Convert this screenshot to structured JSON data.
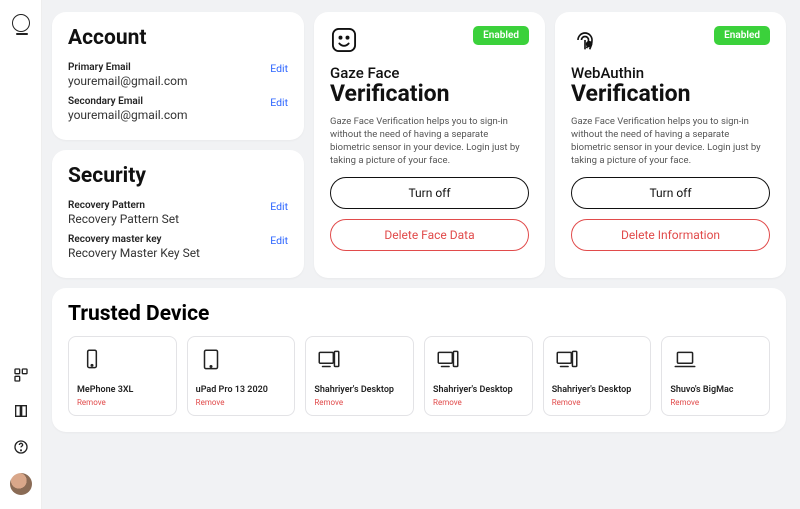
{
  "account": {
    "title": "Account",
    "primary_label": "Primary Email",
    "primary_value": "youremail@gmail.com",
    "secondary_label": "Secondary Email",
    "secondary_value": "youremail@gmail.com",
    "edit": "Edit"
  },
  "security": {
    "title": "Security",
    "pattern_label": "Recovery Pattern",
    "pattern_value": "Recovery Pattern Set",
    "master_label": "Recovery master key",
    "master_value": "Recovery Master Key Set",
    "edit": "Edit"
  },
  "verification": {
    "enabled_badge": "Enabled",
    "gaze": {
      "title_small": "Gaze Face",
      "title_big": "Verification",
      "desc": "Gaze Face Verification helps you to sign-in without the need of having a separate biometric sensor in your device. Login just by taking a picture of your face.",
      "turn_off": "Turn off",
      "delete": "Delete Face Data"
    },
    "webauthn": {
      "title_small": "WebAuthin",
      "title_big": "Verification",
      "desc": "Gaze Face Verification helps you to sign-in without the need of having a separate biometric sensor in your device. Login just by taking a picture of your face.",
      "turn_off": "Turn off",
      "delete": "Delete Information"
    }
  },
  "trusted": {
    "title": "Trusted Device",
    "remove": "Remove",
    "devices": [
      {
        "name": "MePhone 3XL",
        "type": "phone"
      },
      {
        "name": "uPad Pro 13 2020",
        "type": "tablet"
      },
      {
        "name": "Shahriyer's Desktop",
        "type": "desktop"
      },
      {
        "name": "Shahriyer's Desktop",
        "type": "desktop"
      },
      {
        "name": "Shahriyer's Desktop",
        "type": "desktop"
      },
      {
        "name": "Shuvo's BigMac",
        "type": "laptop"
      }
    ]
  }
}
